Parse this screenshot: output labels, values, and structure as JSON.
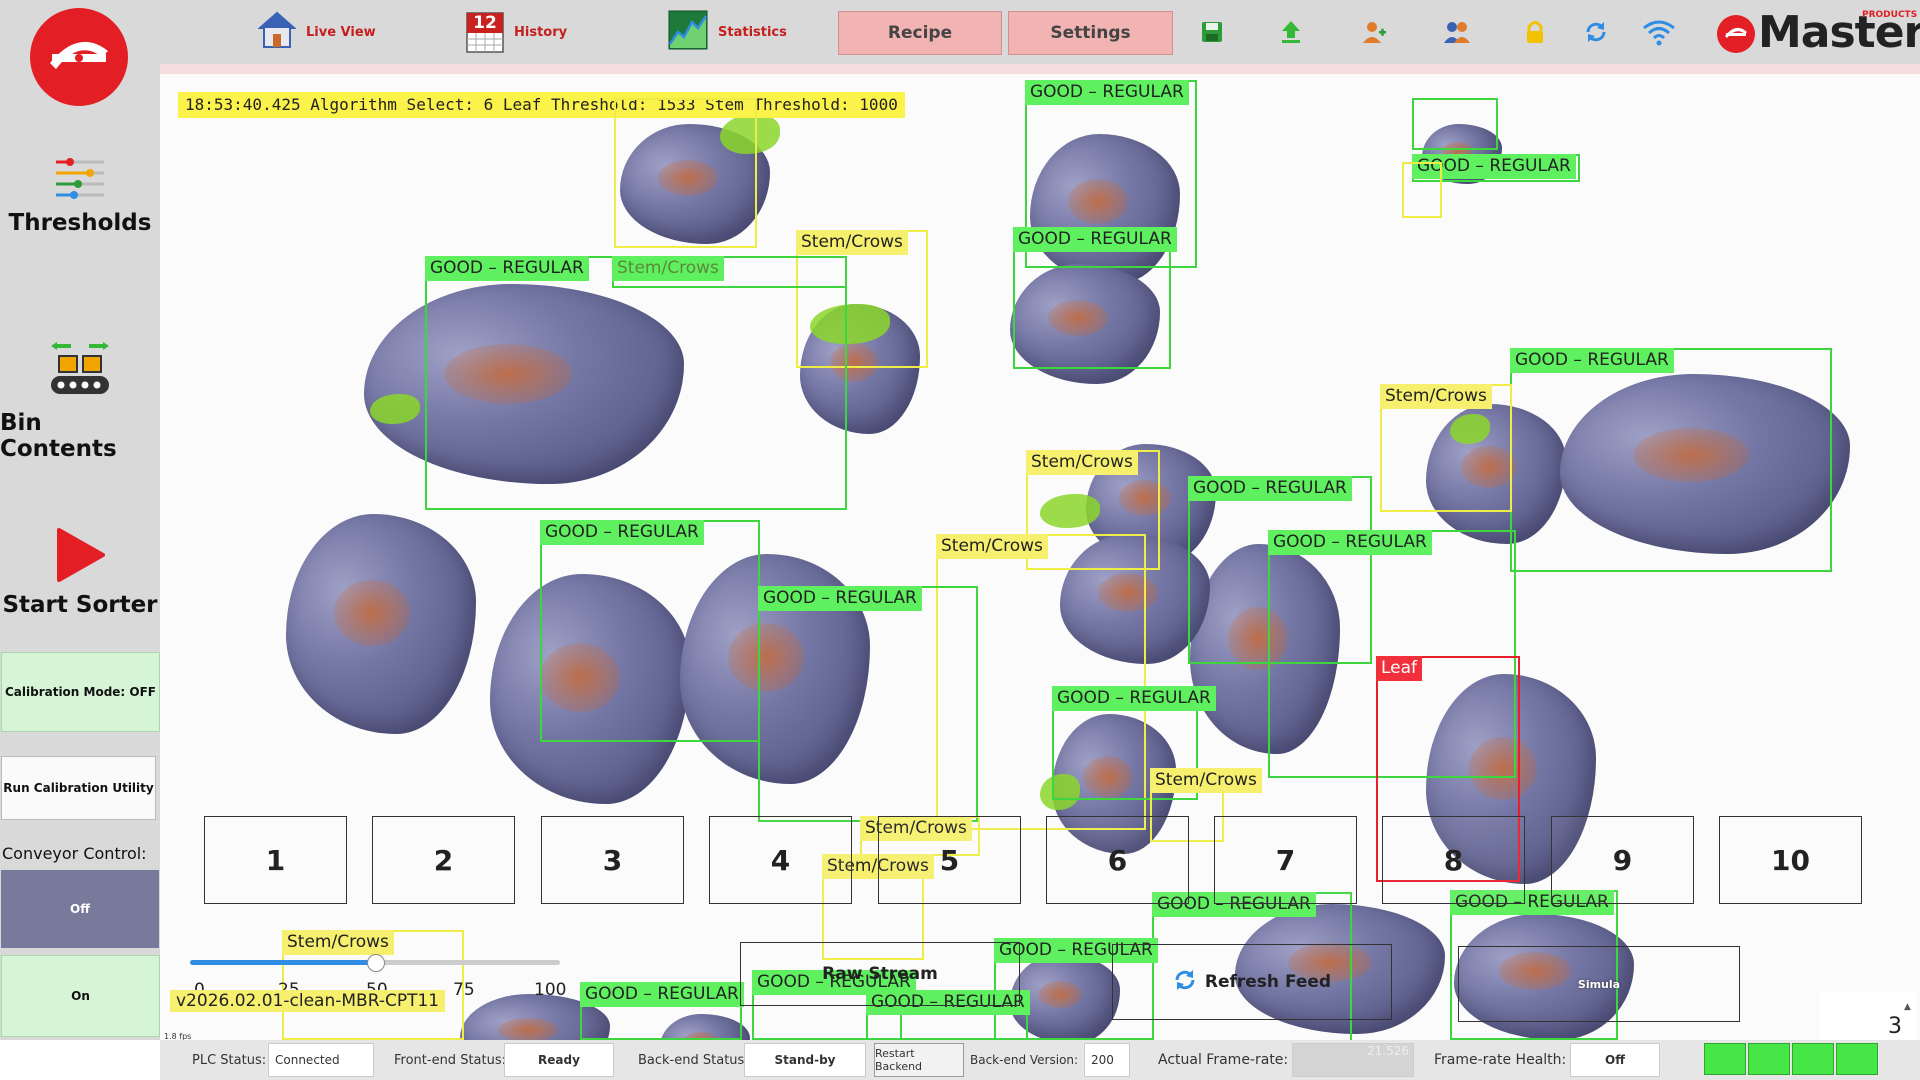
{
  "nav": {
    "live_view": "Live View",
    "history": "History",
    "history_day": "12",
    "statistics": "Statistics",
    "recipe": "Recipe",
    "settings": "Settings"
  },
  "brand": {
    "name": "Master",
    "small": "PRODUCTS",
    "color": "#e31e24"
  },
  "sidebar": {
    "thresholds": "Thresholds",
    "bin_contents": "Bin Contents",
    "start_sorter": "Start Sorter",
    "calibration_mode": "Calibration Mode: OFF",
    "run_calibration": "Run Calibration Utility",
    "conveyor_control": "Conveyor Control:",
    "off": "Off",
    "on": "On"
  },
  "feed": {
    "status_line": "18:53:40.425 Algorithm Select: 6 Leaf Threshold: 1533 Stem Threshold: 1000",
    "labels": {
      "good": "GOOD – REGULAR",
      "stem": "Stem/Crows",
      "leaf": "Leaf"
    },
    "bins": [
      "1",
      "2",
      "3",
      "4",
      "5",
      "6",
      "7",
      "8",
      "9",
      "10"
    ],
    "raw_stream": "Raw Stream",
    "refresh_feed": "Refresh Feed",
    "simula": "Simula",
    "slider_ticks": [
      "0",
      "25",
      "50",
      "75",
      "100"
    ],
    "slider_value": 50,
    "version": "v2026.02.01-clean-MBR-CPT11",
    "fps_small": "1.8 fps",
    "corner_number": "3"
  },
  "status_bar": {
    "plc_label": "PLC Status:",
    "plc_value": "Connected",
    "frontend_label": "Front-end Status:",
    "frontend_value": "Ready",
    "backend_label": "Back-end Status:",
    "backend_value": "Stand-by",
    "restart_backend": "Restart Backend",
    "backend_version_label": "Back-end Version:",
    "backend_version_value": "200",
    "frame_rate_label": "Actual Frame-rate:",
    "frame_rate_value": "21.526",
    "health_label": "Frame-rate Health:",
    "health_value": "Off"
  },
  "colors": {
    "good": "#5ff05f",
    "stem": "#f6f06e",
    "leaf": "#f2303c",
    "accent": "#e31e24"
  },
  "icons": [
    "house-icon",
    "calendar-icon",
    "chart-icon",
    "save-icon",
    "upload-icon",
    "add-user-icon",
    "users-icon",
    "lock-icon",
    "refresh-icon",
    "wifi-icon",
    "sliders-icon",
    "conveyor-icon",
    "play-icon"
  ]
}
